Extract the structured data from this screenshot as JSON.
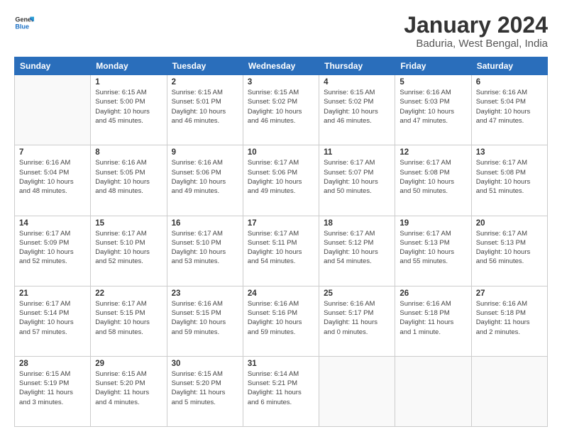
{
  "logo": {
    "line1": "General",
    "line2": "Blue"
  },
  "title": "January 2024",
  "subtitle": "Baduria, West Bengal, India",
  "header_days": [
    "Sunday",
    "Monday",
    "Tuesday",
    "Wednesday",
    "Thursday",
    "Friday",
    "Saturday"
  ],
  "weeks": [
    [
      {
        "date": "",
        "info": ""
      },
      {
        "date": "1",
        "info": "Sunrise: 6:15 AM\nSunset: 5:00 PM\nDaylight: 10 hours\nand 45 minutes."
      },
      {
        "date": "2",
        "info": "Sunrise: 6:15 AM\nSunset: 5:01 PM\nDaylight: 10 hours\nand 46 minutes."
      },
      {
        "date": "3",
        "info": "Sunrise: 6:15 AM\nSunset: 5:02 PM\nDaylight: 10 hours\nand 46 minutes."
      },
      {
        "date": "4",
        "info": "Sunrise: 6:15 AM\nSunset: 5:02 PM\nDaylight: 10 hours\nand 46 minutes."
      },
      {
        "date": "5",
        "info": "Sunrise: 6:16 AM\nSunset: 5:03 PM\nDaylight: 10 hours\nand 47 minutes."
      },
      {
        "date": "6",
        "info": "Sunrise: 6:16 AM\nSunset: 5:04 PM\nDaylight: 10 hours\nand 47 minutes."
      }
    ],
    [
      {
        "date": "7",
        "info": "Sunrise: 6:16 AM\nSunset: 5:04 PM\nDaylight: 10 hours\nand 48 minutes."
      },
      {
        "date": "8",
        "info": "Sunrise: 6:16 AM\nSunset: 5:05 PM\nDaylight: 10 hours\nand 48 minutes."
      },
      {
        "date": "9",
        "info": "Sunrise: 6:16 AM\nSunset: 5:06 PM\nDaylight: 10 hours\nand 49 minutes."
      },
      {
        "date": "10",
        "info": "Sunrise: 6:17 AM\nSunset: 5:06 PM\nDaylight: 10 hours\nand 49 minutes."
      },
      {
        "date": "11",
        "info": "Sunrise: 6:17 AM\nSunset: 5:07 PM\nDaylight: 10 hours\nand 50 minutes."
      },
      {
        "date": "12",
        "info": "Sunrise: 6:17 AM\nSunset: 5:08 PM\nDaylight: 10 hours\nand 50 minutes."
      },
      {
        "date": "13",
        "info": "Sunrise: 6:17 AM\nSunset: 5:08 PM\nDaylight: 10 hours\nand 51 minutes."
      }
    ],
    [
      {
        "date": "14",
        "info": "Sunrise: 6:17 AM\nSunset: 5:09 PM\nDaylight: 10 hours\nand 52 minutes."
      },
      {
        "date": "15",
        "info": "Sunrise: 6:17 AM\nSunset: 5:10 PM\nDaylight: 10 hours\nand 52 minutes."
      },
      {
        "date": "16",
        "info": "Sunrise: 6:17 AM\nSunset: 5:10 PM\nDaylight: 10 hours\nand 53 minutes."
      },
      {
        "date": "17",
        "info": "Sunrise: 6:17 AM\nSunset: 5:11 PM\nDaylight: 10 hours\nand 54 minutes."
      },
      {
        "date": "18",
        "info": "Sunrise: 6:17 AM\nSunset: 5:12 PM\nDaylight: 10 hours\nand 54 minutes."
      },
      {
        "date": "19",
        "info": "Sunrise: 6:17 AM\nSunset: 5:13 PM\nDaylight: 10 hours\nand 55 minutes."
      },
      {
        "date": "20",
        "info": "Sunrise: 6:17 AM\nSunset: 5:13 PM\nDaylight: 10 hours\nand 56 minutes."
      }
    ],
    [
      {
        "date": "21",
        "info": "Sunrise: 6:17 AM\nSunset: 5:14 PM\nDaylight: 10 hours\nand 57 minutes."
      },
      {
        "date": "22",
        "info": "Sunrise: 6:17 AM\nSunset: 5:15 PM\nDaylight: 10 hours\nand 58 minutes."
      },
      {
        "date": "23",
        "info": "Sunrise: 6:16 AM\nSunset: 5:15 PM\nDaylight: 10 hours\nand 59 minutes."
      },
      {
        "date": "24",
        "info": "Sunrise: 6:16 AM\nSunset: 5:16 PM\nDaylight: 10 hours\nand 59 minutes."
      },
      {
        "date": "25",
        "info": "Sunrise: 6:16 AM\nSunset: 5:17 PM\nDaylight: 11 hours\nand 0 minutes."
      },
      {
        "date": "26",
        "info": "Sunrise: 6:16 AM\nSunset: 5:18 PM\nDaylight: 11 hours\nand 1 minute."
      },
      {
        "date": "27",
        "info": "Sunrise: 6:16 AM\nSunset: 5:18 PM\nDaylight: 11 hours\nand 2 minutes."
      }
    ],
    [
      {
        "date": "28",
        "info": "Sunrise: 6:15 AM\nSunset: 5:19 PM\nDaylight: 11 hours\nand 3 minutes."
      },
      {
        "date": "29",
        "info": "Sunrise: 6:15 AM\nSunset: 5:20 PM\nDaylight: 11 hours\nand 4 minutes."
      },
      {
        "date": "30",
        "info": "Sunrise: 6:15 AM\nSunset: 5:20 PM\nDaylight: 11 hours\nand 5 minutes."
      },
      {
        "date": "31",
        "info": "Sunrise: 6:14 AM\nSunset: 5:21 PM\nDaylight: 11 hours\nand 6 minutes."
      },
      {
        "date": "",
        "info": ""
      },
      {
        "date": "",
        "info": ""
      },
      {
        "date": "",
        "info": ""
      }
    ]
  ]
}
